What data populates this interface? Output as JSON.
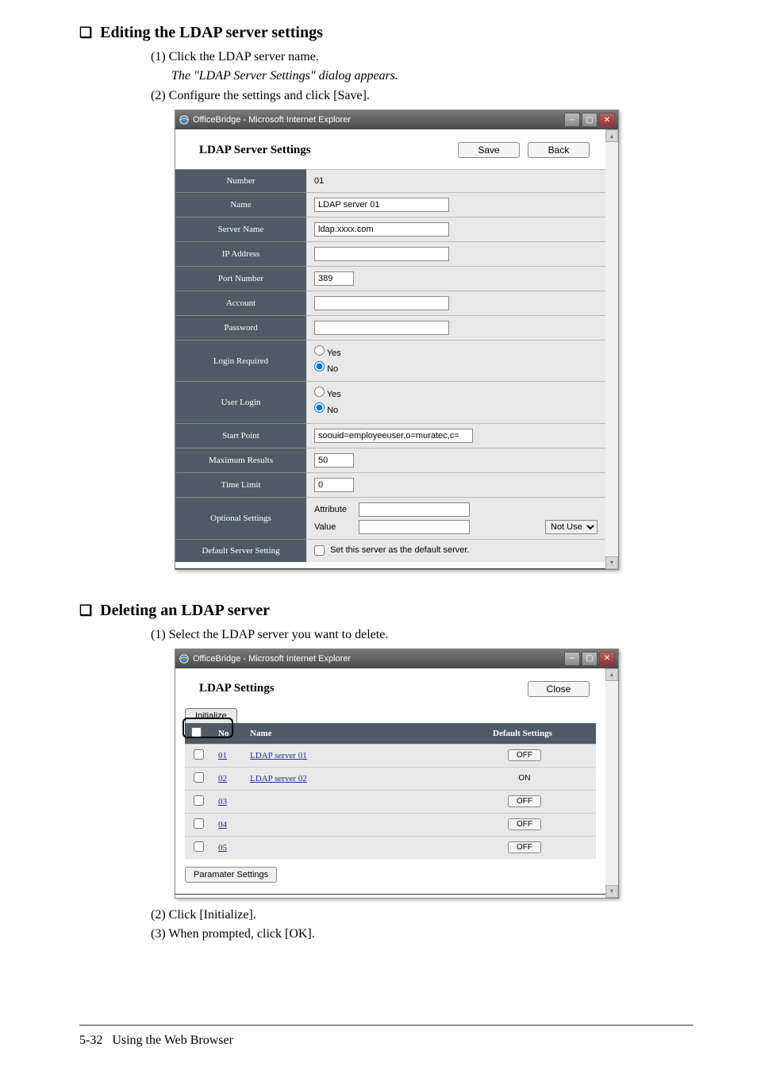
{
  "section1": {
    "heading": "Editing the LDAP server settings",
    "step1": "(1) Click the LDAP server name.",
    "step1_italic": "The \"LDAP Server Settings\" dialog appears.",
    "step2": "(2) Configure the settings and click [Save]."
  },
  "ie_title": "OfficeBridge - Microsoft Internet Explorer",
  "dlg1": {
    "title": "LDAP Server Settings",
    "save": "Save",
    "back": "Back",
    "rows": {
      "number_label": "Number",
      "number_val": "01",
      "name_label": "Name",
      "name_val": "LDAP server 01",
      "server_label": "Server Name",
      "server_val": "ldap.xxxx.com",
      "ip_label": "IP Address",
      "ip_val": "",
      "port_label": "Port Number",
      "port_val": "389",
      "account_label": "Account",
      "account_val": "",
      "password_label": "Password",
      "password_val": "",
      "login_req_label": "Login Required",
      "yes": "Yes",
      "no": "No",
      "user_login_label": "User Login",
      "start_label": "Start Point",
      "start_val": "soouid=employeeuser,o=muratec,c=",
      "max_label": "Maximum Results",
      "max_val": "50",
      "time_label": "Time Limit",
      "time_val": "0",
      "opt_label": "Optional Settings",
      "opt_attr": "Attribute",
      "opt_value": "Value",
      "opt_select": "Not Use",
      "default_label": "Default Server Setting",
      "default_cb": "Set this server as the default server."
    }
  },
  "section2": {
    "heading": "Deleting an LDAP server",
    "step1": "(1) Select the LDAP server you want to delete.",
    "step2": "(2) Click [Initialize].",
    "step3": "(3) When prompted, click [OK]."
  },
  "dlg2": {
    "title": "LDAP Settings",
    "close": "Close",
    "tab": "Initialize",
    "cols": {
      "no": "No",
      "name": "Name",
      "def": "Default Settings"
    },
    "rows": [
      {
        "no": "01",
        "name": "LDAP server 01",
        "def": "OFF"
      },
      {
        "no": "02",
        "name": "LDAP server 02",
        "def": "ON"
      },
      {
        "no": "03",
        "name": "",
        "def": "OFF"
      },
      {
        "no": "04",
        "name": "",
        "def": "OFF"
      },
      {
        "no": "05",
        "name": "",
        "def": "OFF"
      }
    ],
    "param_btn": "Paramater Settings"
  },
  "footer": {
    "page": "5-32",
    "title": "Using the Web Browser"
  }
}
